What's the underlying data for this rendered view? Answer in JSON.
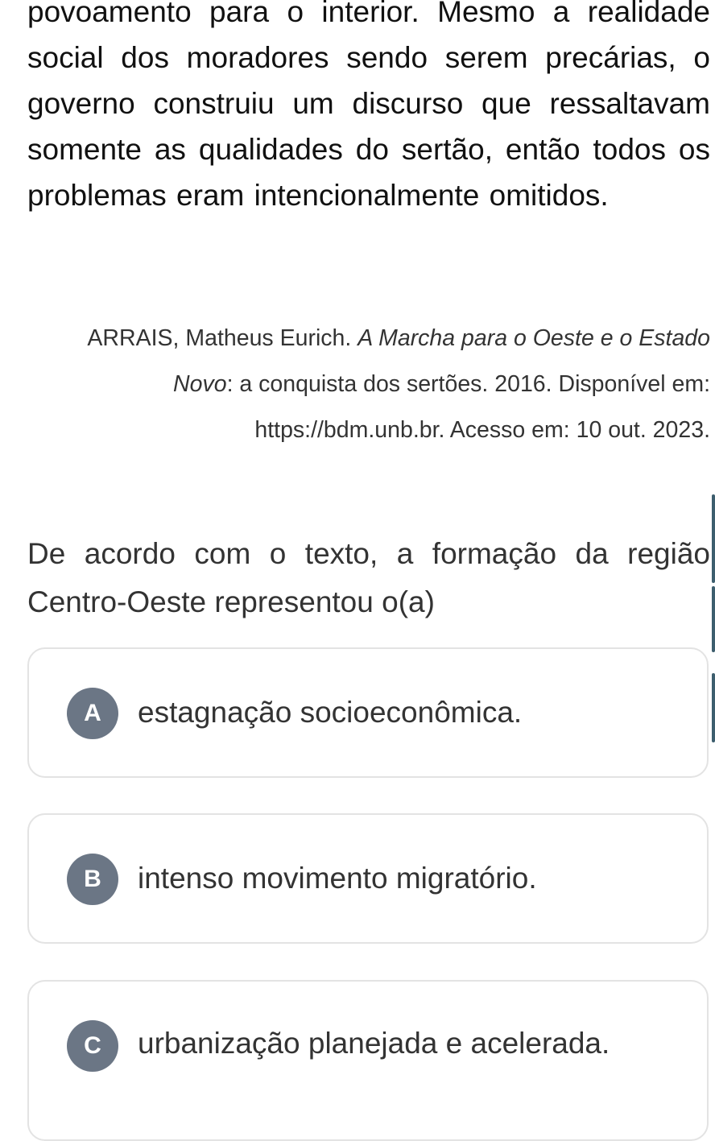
{
  "passage": {
    "text": "povoamento para o interior. Mesmo a realidade social dos moradores sendo serem precárias, o governo construiu um discurso que ressaltavam somente as qualidades do sertão, então todos os problemas eram intencionalmente omitidos."
  },
  "citation": {
    "author": "ARRAIS, Matheus Eurich. ",
    "title_part1": "A Marcha para o Oeste e o Estado Novo",
    "subtitle": ": a conquista dos sertões. 2016.",
    "availability": "Disponível em: https://bdm.unb.br. Acesso em: 10 out. 2023."
  },
  "question": {
    "text": "De acordo com o texto, a formação da região Centro-Oeste representou o(a)"
  },
  "options": [
    {
      "letter": "A",
      "text": "estagnação socioeconômica."
    },
    {
      "letter": "B",
      "text": "intenso movimento migratório."
    },
    {
      "letter": "C",
      "text": "urbanização planejada e acelerada."
    }
  ],
  "colors": {
    "badge": "#6b7685",
    "side_accent": "#3d5e6e",
    "card_border": "#e3e3e3"
  }
}
